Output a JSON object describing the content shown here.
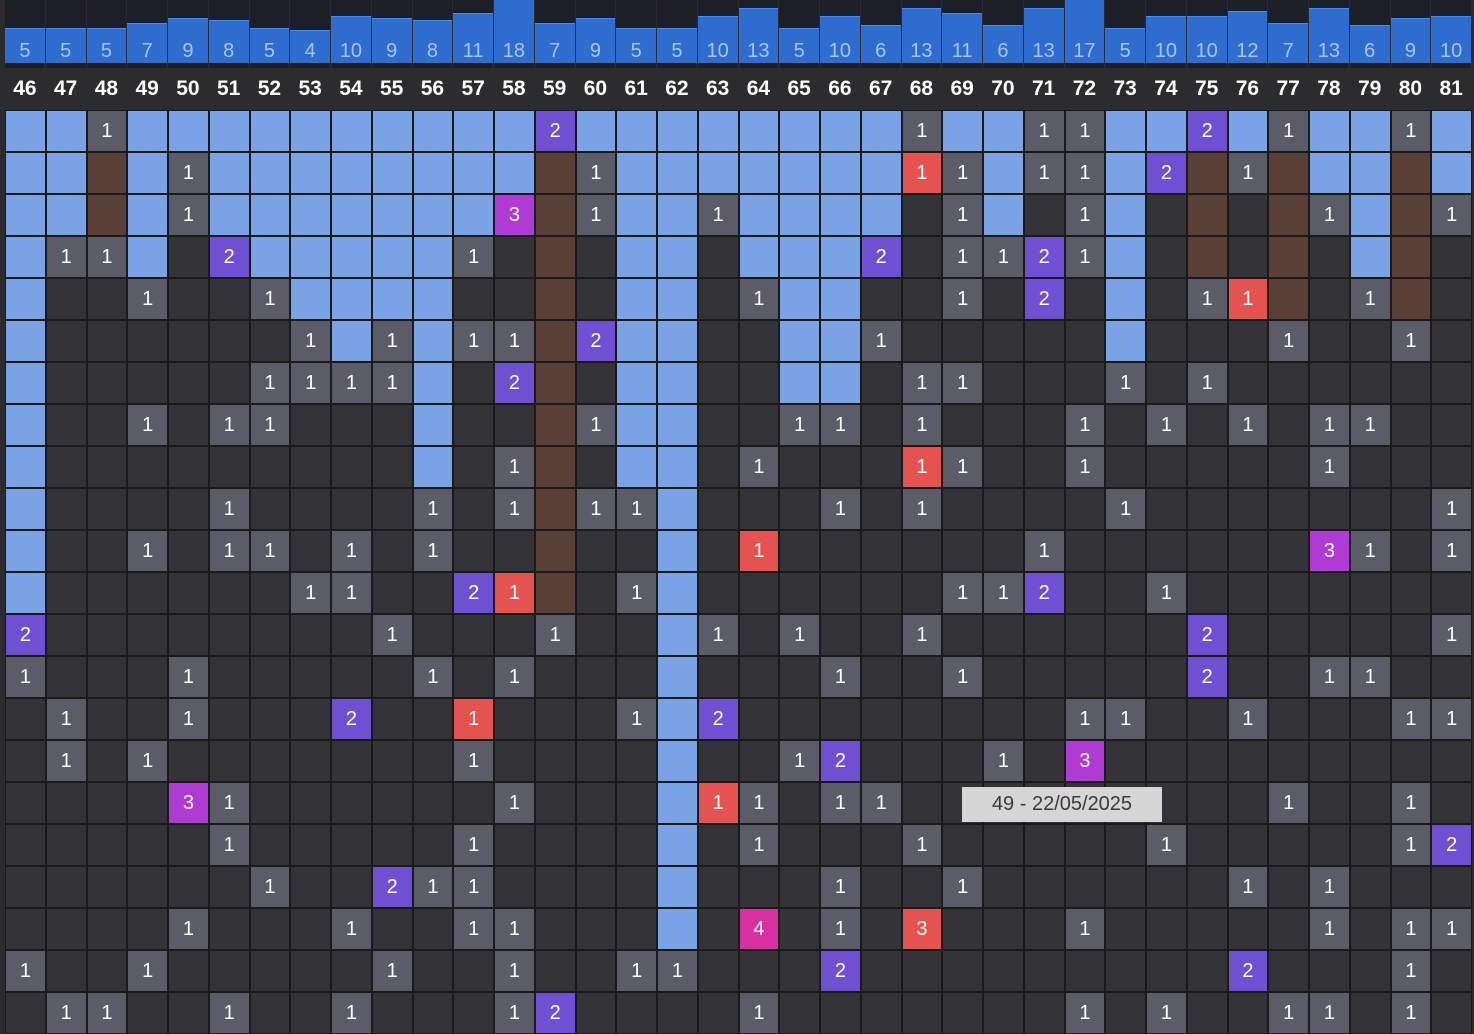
{
  "columns": [
    46,
    47,
    48,
    49,
    50,
    51,
    52,
    53,
    54,
    55,
    56,
    57,
    58,
    59,
    60,
    61,
    62,
    63,
    64,
    65,
    66,
    67,
    68,
    69,
    70,
    71,
    72,
    73,
    74,
    75,
    76,
    77,
    78,
    79,
    80,
    81
  ],
  "column_counts": [
    5,
    5,
    5,
    7,
    9,
    8,
    5,
    4,
    10,
    9,
    8,
    11,
    18,
    7,
    9,
    5,
    5,
    10,
    13,
    5,
    10,
    6,
    13,
    11,
    6,
    13,
    17,
    5,
    10,
    10,
    12,
    7,
    13,
    6,
    9,
    10
  ],
  "legend_colors": {
    "band": "#7aa3e5",
    "brown": "#5a3f37",
    "empty": "#333338",
    "gray": "#5b5c68",
    "red": "#e55350",
    "purple": "#7050d2",
    "magenta": "#b03ad4",
    "pink": "#d8309e"
  },
  "rows": [
    [
      "B",
      "B",
      "1",
      "B",
      "B",
      "B",
      "B",
      "B",
      "B",
      "B",
      "B",
      "B",
      "B",
      "P2",
      "B",
      "B",
      "B",
      "B",
      "B",
      "B",
      "B",
      "B",
      "1",
      "B",
      "B",
      "1",
      "1",
      "B",
      "B",
      "P2",
      "B",
      "1",
      "B",
      "B",
      "1",
      "B"
    ],
    [
      "B",
      "B",
      "W",
      "B",
      "1",
      "B",
      "B",
      "B",
      "B",
      "B",
      "B",
      "B",
      "B",
      "W",
      "1",
      "B",
      "B",
      "B",
      "B",
      "B",
      "B",
      "B",
      "R1",
      "1",
      "B",
      "1",
      "1",
      "B",
      "P2",
      "W",
      "1",
      "W",
      "B",
      "B",
      "W",
      "B"
    ],
    [
      "B",
      "B",
      "W",
      "B",
      "1",
      "B",
      "B",
      "B",
      "B",
      "B",
      "B",
      "B",
      "M3",
      "W",
      "1",
      "B",
      "B",
      "1",
      "B",
      "B",
      "B",
      "B",
      "",
      "1",
      "B",
      "",
      "1",
      "B",
      "",
      "W",
      "",
      "W",
      "1",
      "B",
      "W",
      "1"
    ],
    [
      "B",
      "1",
      "1",
      "B",
      "",
      "P2",
      "B",
      "B",
      "B",
      "B",
      "B",
      "1",
      "",
      "W",
      "",
      "B",
      "B",
      "",
      "B",
      "B",
      "B",
      "P2",
      "",
      "1",
      "1",
      "P2",
      "1",
      "B",
      "",
      "W",
      "",
      "W",
      "",
      "B",
      "W",
      ""
    ],
    [
      "B",
      "",
      "",
      "1",
      "",
      "",
      "1",
      "B",
      "B",
      "B",
      "B",
      "",
      "",
      "W",
      "",
      "B",
      "B",
      "",
      "1",
      "B",
      "B",
      "",
      "",
      "1",
      "",
      "P2",
      "",
      "B",
      "",
      "1",
      "R1",
      "W",
      "",
      "1",
      "W",
      ""
    ],
    [
      "B",
      "",
      "",
      "",
      "",
      "",
      "",
      "1",
      "B",
      "1",
      "B",
      "1",
      "1",
      "W",
      "P2",
      "B",
      "B",
      "",
      "",
      "B",
      "B",
      "1",
      "",
      "",
      "",
      "",
      "",
      "B",
      "",
      "",
      "",
      "1",
      "",
      "",
      "1",
      ""
    ],
    [
      "B",
      "",
      "",
      "",
      "",
      "",
      "1",
      "1",
      "1",
      "1",
      "B",
      "",
      "P2",
      "W",
      "",
      "B",
      "B",
      "",
      "",
      "B",
      "B",
      "",
      "1",
      "1",
      "",
      "",
      "",
      "1",
      "",
      "1",
      "",
      "",
      "",
      "",
      "",
      ""
    ],
    [
      "B",
      "",
      "",
      "1",
      "",
      "1",
      "1",
      "",
      "",
      "",
      "B",
      "",
      "",
      "W",
      "1",
      "B",
      "B",
      "",
      "",
      "1",
      "1",
      "",
      "1",
      "",
      "",
      "",
      "1",
      "",
      "1",
      "",
      "1",
      "",
      "1",
      "1",
      "",
      ""
    ],
    [
      "B",
      "",
      "",
      "",
      "",
      "",
      "",
      "",
      "",
      "",
      "B",
      "",
      "1",
      "W",
      "",
      "B",
      "B",
      "",
      "1",
      "",
      "",
      "",
      "R1",
      "1",
      "",
      "",
      "1",
      "",
      "",
      "",
      "",
      "",
      "1",
      "",
      "",
      ""
    ],
    [
      "B",
      "",
      "",
      "",
      "",
      "1",
      "",
      "",
      "",
      "",
      "1",
      "",
      "1",
      "W",
      "1",
      "1",
      "B",
      "",
      "",
      "",
      "1",
      "",
      "1",
      "",
      "",
      "",
      "",
      "1",
      "",
      "",
      "",
      "",
      "",
      "",
      "",
      "1"
    ],
    [
      "B",
      "",
      "",
      "1",
      "",
      "1",
      "1",
      "",
      "1",
      "",
      "1",
      "",
      "",
      "W",
      "",
      "",
      "B",
      "",
      "R1",
      "",
      "",
      "",
      "",
      "",
      "",
      "1",
      "",
      "",
      "",
      "",
      "",
      "",
      "M3",
      "1",
      "",
      "1"
    ],
    [
      "B",
      "",
      "",
      "",
      "",
      "",
      "",
      "1",
      "1",
      "",
      "",
      "P2",
      "R1",
      "W",
      "",
      "1",
      "B",
      "",
      "",
      "",
      "",
      "",
      "",
      "1",
      "1",
      "P2",
      "",
      "",
      "1",
      "",
      "",
      "",
      "",
      "",
      "",
      ""
    ],
    [
      "P2",
      "",
      "",
      "",
      "",
      "",
      "",
      "",
      "",
      "1",
      "",
      "",
      "",
      "1",
      "",
      "",
      "B",
      "1",
      "",
      "1",
      "",
      "",
      "1",
      "",
      "",
      "",
      "",
      "",
      "",
      "P2",
      "",
      "",
      "",
      "",
      "",
      "1"
    ],
    [
      "1",
      "",
      "",
      "",
      "1",
      "",
      "",
      "",
      "",
      "",
      "1",
      "",
      "1",
      "",
      "",
      "",
      "B",
      "",
      "",
      "",
      "1",
      "",
      "",
      "1",
      "",
      "",
      "",
      "",
      "",
      "P2",
      "",
      "",
      "1",
      "1",
      "",
      ""
    ],
    [
      "",
      "1",
      "",
      "",
      "1",
      "",
      "",
      "",
      "P2",
      "",
      "",
      "R1",
      "",
      "",
      "",
      "1",
      "B",
      "P2",
      "",
      "",
      "",
      "",
      "",
      "",
      "",
      "",
      "1",
      "1",
      "",
      "",
      "1",
      "",
      "",
      "",
      "1",
      "1"
    ],
    [
      "",
      "1",
      "",
      "1",
      "",
      "",
      "",
      "",
      "",
      "",
      "",
      "1",
      "",
      "",
      "",
      "",
      "B",
      "",
      "",
      "1",
      "P2",
      "",
      "",
      "",
      "1",
      "",
      "M3",
      "",
      "",
      "",
      "",
      "",
      "",
      "",
      "",
      ""
    ],
    [
      "",
      "",
      "",
      "",
      "M3",
      "1",
      "",
      "",
      "",
      "",
      "",
      "",
      "1",
      "",
      "",
      "",
      "B",
      "R1",
      "1",
      "",
      "1",
      "1",
      "",
      "",
      "",
      "",
      "",
      "",
      "",
      "",
      "",
      "1",
      "",
      "",
      "1",
      ""
    ],
    [
      "",
      "",
      "",
      "",
      "",
      "1",
      "",
      "",
      "",
      "",
      "",
      "1",
      "",
      "",
      "",
      "",
      "B",
      "",
      "1",
      "",
      "",
      "",
      "1",
      "",
      "",
      "",
      "",
      "",
      "1",
      "",
      "",
      "",
      "",
      "",
      "1",
      "P2"
    ],
    [
      "",
      "",
      "",
      "",
      "",
      "",
      "1",
      "",
      "",
      "P2",
      "1",
      "1",
      "",
      "",
      "",
      "",
      "B",
      "",
      "",
      "",
      "1",
      "",
      "",
      "1",
      "",
      "",
      "",
      "",
      "",
      "",
      "1",
      "",
      "1",
      "",
      "",
      ""
    ],
    [
      "",
      "",
      "",
      "",
      "1",
      "",
      "",
      "",
      "1",
      "",
      "",
      "1",
      "1",
      "",
      "",
      "",
      "B",
      "",
      "K4",
      "",
      "1",
      "",
      "R3",
      "",
      "",
      "",
      "1",
      "",
      "",
      "",
      "",
      "",
      "1",
      "",
      "1",
      "1"
    ],
    [
      "1",
      "",
      "",
      "1",
      "",
      "",
      "",
      "",
      "",
      "1",
      "",
      "",
      "1",
      "",
      "",
      "1",
      "1",
      "",
      "",
      "",
      "P2",
      "",
      "",
      "",
      "",
      "",
      "",
      "",
      "",
      "",
      "P2",
      "",
      "",
      "",
      "1",
      ""
    ],
    [
      "",
      "1",
      "1",
      "",
      "",
      "1",
      "",
      "",
      "1",
      "",
      "",
      "",
      "1",
      "P2",
      "",
      "",
      "",
      "",
      "1",
      "",
      "",
      "",
      "",
      "",
      "",
      "",
      "1",
      "",
      "1",
      "",
      "",
      "1",
      "1",
      "",
      "1",
      ""
    ]
  ],
  "tooltip": {
    "text": "49 - 22/05/2025"
  }
}
